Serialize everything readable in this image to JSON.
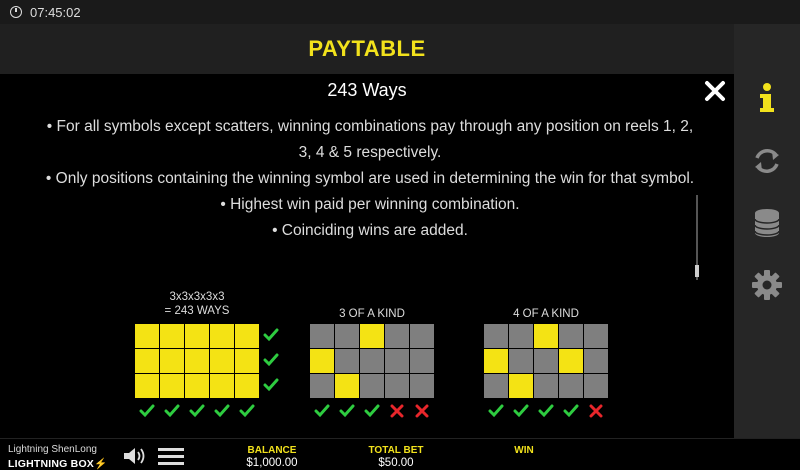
{
  "status_bar": {
    "time": "07:45:02"
  },
  "header": {
    "title": "PAYTABLE"
  },
  "section": {
    "heading": "243 Ways"
  },
  "rules": [
    "• For all symbols except scatters, winning combinations pay through any position on reels 1, 2, 3, 4 & 5 respectively.",
    "• Only positions containing the winning symbol are used in determining the win for that symbol.",
    "• Highest win paid per winning combination.",
    "• Coinciding wins are added."
  ],
  "examples": [
    {
      "label_line1": "3x3x3x3x3",
      "label_line2": "= 243 WAYS",
      "grid": [
        [
          1,
          1,
          1,
          1,
          1
        ],
        [
          1,
          1,
          1,
          1,
          1
        ],
        [
          1,
          1,
          1,
          1,
          1
        ]
      ],
      "reel_marks": [
        "check",
        "check",
        "check",
        "check",
        "check"
      ],
      "row_marks": [
        "check",
        "check",
        "check"
      ]
    },
    {
      "label_line1": "3 OF A KIND",
      "grid": [
        [
          0,
          0,
          1,
          0,
          0
        ],
        [
          1,
          0,
          0,
          0,
          0
        ],
        [
          0,
          1,
          0,
          0,
          0
        ]
      ],
      "reel_marks": [
        "check",
        "check",
        "check",
        "cross",
        "cross"
      ]
    },
    {
      "label_line1": "4 OF A KIND",
      "grid": [
        [
          0,
          0,
          1,
          0,
          0
        ],
        [
          1,
          0,
          0,
          1,
          0
        ],
        [
          0,
          1,
          0,
          0,
          0
        ]
      ],
      "reel_marks": [
        "check",
        "check",
        "check",
        "check",
        "cross"
      ]
    }
  ],
  "sidebar": {
    "icons": [
      "info-icon",
      "autoplay-icon",
      "coins-icon",
      "gear-icon"
    ]
  },
  "footer": {
    "game_name": "Lightning ShenLong",
    "brand": "LIGHTNING BOX",
    "balance_label": "BALANCE",
    "balance_value": "$1,000.00",
    "total_bet_label": "TOTAL BET",
    "total_bet_value": "$50.00",
    "win_label": "WIN",
    "win_value": ""
  },
  "colors": {
    "accent_yellow": "#f2e21c",
    "cell_on": "#f4e314",
    "cell_off": "#7f7f7f",
    "check_green": "#2ecc40",
    "cross_red": "#e8262b"
  }
}
